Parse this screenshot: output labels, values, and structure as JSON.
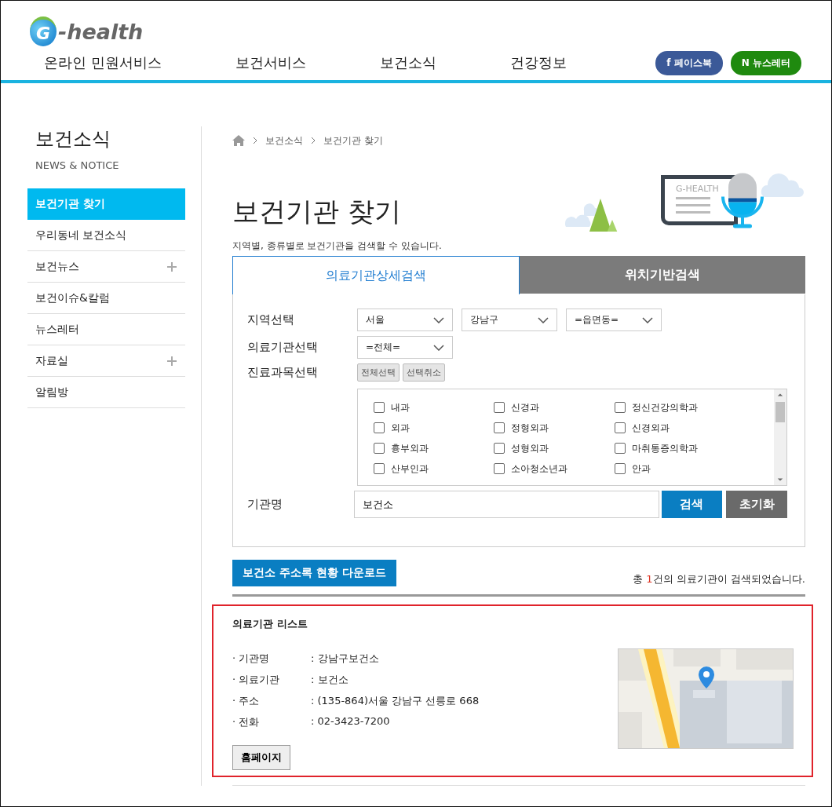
{
  "logo": {
    "letter": "G",
    "text": "-health"
  },
  "nav": [
    "온라인 민원서비스",
    "보건서비스",
    "보건소식",
    "건강정보"
  ],
  "social": [
    {
      "kind": "facebook",
      "icon": "f",
      "label": "페이스북"
    },
    {
      "kind": "newsletter",
      "icon": "N",
      "label": "뉴스레터"
    }
  ],
  "sidebar": {
    "title": "보건소식",
    "subtitle": "NEWS & NOTICE",
    "items": [
      {
        "label": "보건기관 찾기",
        "selected": true,
        "expandable": false
      },
      {
        "label": "우리동네 보건소식",
        "selected": false,
        "expandable": false
      },
      {
        "label": "보건뉴스",
        "selected": false,
        "expandable": true
      },
      {
        "label": "보건이슈&칼럼",
        "selected": false,
        "expandable": false
      },
      {
        "label": "뉴스레터",
        "selected": false,
        "expandable": false
      },
      {
        "label": "자료실",
        "selected": false,
        "expandable": true
      },
      {
        "label": "알림방",
        "selected": false,
        "expandable": false
      }
    ]
  },
  "breadcrumb": [
    "보건소식",
    "보건기관 찾기"
  ],
  "page_title": "보건기관 찾기",
  "banner_label": "G-HEALTH",
  "description": "지역별, 종류별로 보건기관을 검색할 수 있습니다.",
  "tabs": [
    {
      "label": "의료기관상세검색",
      "selected": true
    },
    {
      "label": "위치기반검색",
      "selected": false
    }
  ],
  "form": {
    "region_label": "지역선택",
    "region_selects": [
      "서울",
      "강남구",
      "=읍면동="
    ],
    "type_label": "의료기관선택",
    "type_select": "=전체=",
    "dept_label": "진료과목선택",
    "dept_buttons": [
      "전체선택",
      "선택취소"
    ],
    "departments": [
      {
        "label": "내과",
        "checked": false
      },
      {
        "label": "신경과",
        "checked": false
      },
      {
        "label": "정신건강의학과",
        "checked": false
      },
      {
        "label": "외과",
        "checked": false
      },
      {
        "label": "정형외과",
        "checked": false
      },
      {
        "label": "신경외과",
        "checked": false
      },
      {
        "label": "흉부외과",
        "checked": false
      },
      {
        "label": "성형외과",
        "checked": false
      },
      {
        "label": "마취통증의학과",
        "checked": false
      },
      {
        "label": "산부인과",
        "checked": false
      },
      {
        "label": "소아청소년과",
        "checked": false
      },
      {
        "label": "안과",
        "checked": false
      }
    ],
    "name_label": "기관명",
    "name_value": "보건소",
    "search_button": "검색",
    "reset_button": "초기화"
  },
  "download_button": "보건소 주소록 현황 다운로드",
  "result_count": {
    "before": "총 ",
    "count": "1",
    "after": "건의 의료기관이 검색되었습니다."
  },
  "result": {
    "title": "의료기관 리스트",
    "fields": [
      {
        "label": "· 기관명",
        "value": ": 강남구보건소"
      },
      {
        "label": "· 의료기관",
        "value": ": 보건소"
      },
      {
        "label": "· 주소",
        "value": ": (135-864)서울 강남구 선릉로 668"
      },
      {
        "label": "· 전화",
        "value": ": 02-3423-7200"
      }
    ],
    "homepage_button": "홈페이지"
  }
}
